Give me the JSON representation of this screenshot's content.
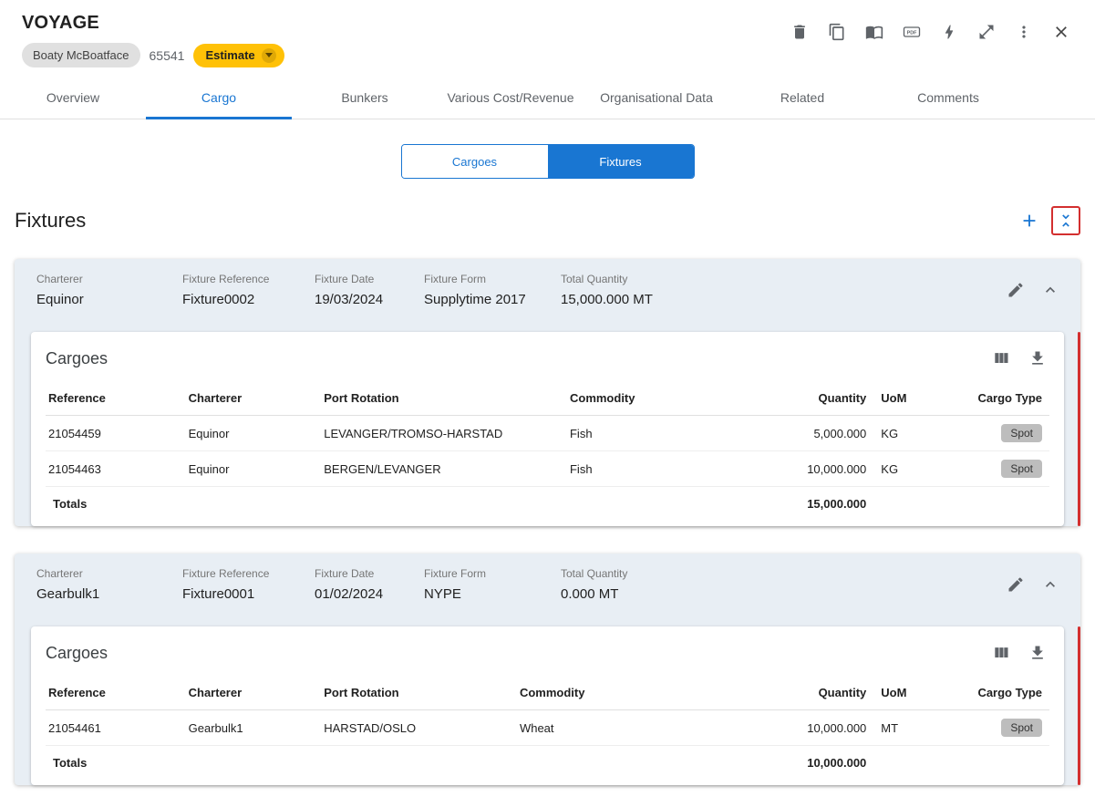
{
  "header": {
    "title": "VOYAGE",
    "vessel_chip": "Boaty McBoatface",
    "voyage_number": "65541",
    "estimate_label": "Estimate",
    "toolbar_icons": [
      "delete",
      "copy",
      "menu-book",
      "pdf",
      "lightning",
      "expand",
      "more-options",
      "close"
    ]
  },
  "icon_glyphs": {
    "pdf": "PDF"
  },
  "tabs": [
    {
      "label": "Overview",
      "active": false
    },
    {
      "label": "Cargo",
      "active": true
    },
    {
      "label": "Bunkers",
      "active": false
    },
    {
      "label": "Various Cost/Revenue",
      "active": false
    },
    {
      "label": "Organisational Data",
      "active": false
    },
    {
      "label": "Related",
      "active": false
    },
    {
      "label": "Comments",
      "active": false
    }
  ],
  "view_toggle": {
    "options": [
      {
        "label": "Cargoes",
        "active": false
      },
      {
        "label": "Fixtures",
        "active": true
      }
    ]
  },
  "section": {
    "title": "Fixtures"
  },
  "fixture_labels": {
    "charterer": "Charterer",
    "reference": "Fixture Reference",
    "date": "Fixture Date",
    "form": "Fixture Form",
    "total_quantity": "Total Quantity"
  },
  "cargo_table": {
    "title": "Cargoes",
    "columns": [
      "Reference",
      "Charterer",
      "Port Rotation",
      "Commodity",
      "Quantity",
      "UoM",
      "Cargo Type"
    ],
    "totals_label": "Totals"
  },
  "fixtures": [
    {
      "charterer": "Equinor",
      "reference": "Fixture0002",
      "date": "19/03/2024",
      "form": "Supplytime 2017",
      "total_quantity": "15,000.000 MT",
      "rows": [
        {
          "reference": "21054459",
          "charterer": "Equinor",
          "port_rotation": "LEVANGER/TROMSO-HARSTAD",
          "commodity": "Fish",
          "quantity": "5,000.000",
          "uom": "KG",
          "cargo_type": "Spot"
        },
        {
          "reference": "21054463",
          "charterer": "Equinor",
          "port_rotation": "BERGEN/LEVANGER",
          "commodity": "Fish",
          "quantity": "10,000.000",
          "uom": "KG",
          "cargo_type": "Spot"
        }
      ],
      "totals_quantity": "15,000.000"
    },
    {
      "charterer": "Gearbulk1",
      "reference": "Fixture0001",
      "date": "01/02/2024",
      "form": "NYPE",
      "total_quantity": "0.000 MT",
      "rows": [
        {
          "reference": "21054461",
          "charterer": "Gearbulk1",
          "port_rotation": "HARSTAD/OSLO",
          "commodity": "Wheat",
          "quantity": "10,000.000",
          "uom": "MT",
          "cargo_type": "Spot"
        }
      ],
      "totals_quantity": "10,000.000"
    }
  ],
  "colors": {
    "accent_blue": "#1976D2",
    "estimate_amber": "#FFC107",
    "indicator_red": "#D32F2F",
    "card_header_blue": "#E8EEF4",
    "chip_gray": "#BDBDBD"
  }
}
